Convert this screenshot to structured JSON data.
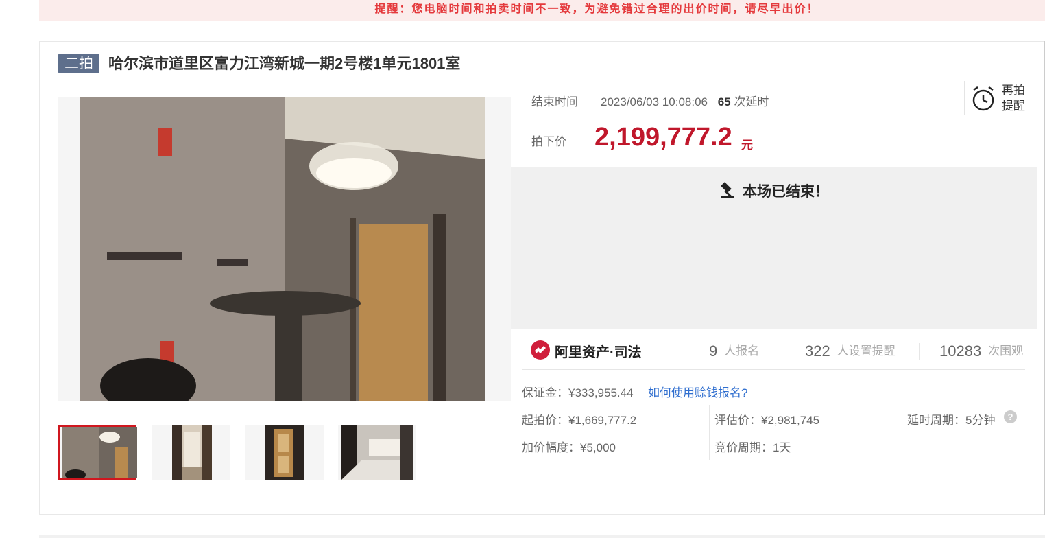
{
  "notice": "提醒：您电脑时间和拍卖时间不一致，为避免错过合理的出价时间，请尽早出价！",
  "lot": {
    "round_badge": "二拍",
    "title": "哈尔滨市道里区富力江湾新城一期2号楼1单元1801室"
  },
  "auction": {
    "end_label": "结束时间",
    "end_time": "2023/06/03 10:08:06",
    "delay_count": "65",
    "delay_suffix": "次延时",
    "price_label": "拍下价",
    "price": "2,199,777.2",
    "price_unit": "元",
    "status": "本场已结束！"
  },
  "reminder": {
    "label_line1": "再拍",
    "label_line2": "提醒"
  },
  "brand": {
    "name": "阿里资产·司法"
  },
  "stats": {
    "signups_num": "9",
    "signups_label": "人报名",
    "reminders_num": "322",
    "reminders_label": "人设置提醒",
    "views_num": "10283",
    "views_label": "次围观"
  },
  "details": {
    "deposit": "保证金：¥333,955.44",
    "deposit_link": "如何使用赊钱报名?",
    "start_price": "起拍价：¥1,669,777.2",
    "appraisal": "评估价：¥2,981,745",
    "delay_period": "延时周期：5分钟",
    "increment": "加价幅度：¥5,000",
    "bid_period": "竞价周期：1天",
    "help_glyph": "?"
  },
  "colors": {
    "accent_red": "#c0172b",
    "badge_blue": "#5e6f8c",
    "link_blue": "#2f6ecf"
  }
}
